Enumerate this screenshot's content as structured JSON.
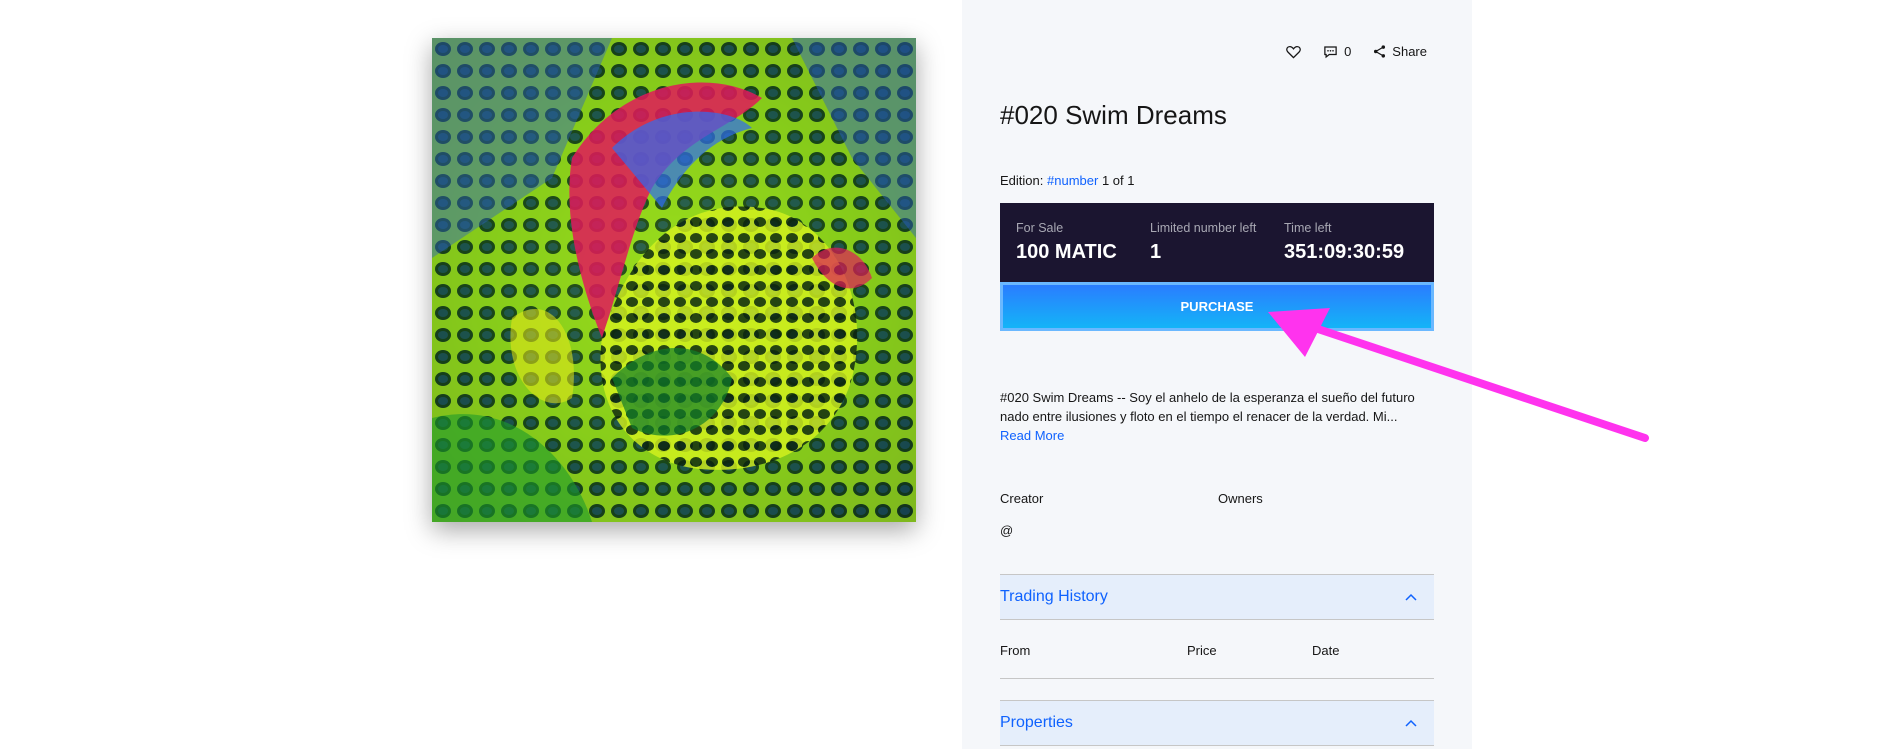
{
  "actions": {
    "comment_count": "0",
    "share_label": "Share"
  },
  "item": {
    "title": "#020 Swim Dreams",
    "edition_label": "Edition:",
    "edition_tag": "#number",
    "edition_value": "1 of 1"
  },
  "sale": {
    "for_sale_label": "For Sale",
    "for_sale_value": "100 MATIC",
    "limited_label": "Limited number left",
    "limited_value": "1",
    "time_label": "Time left",
    "time_value": "351:09:30:59",
    "purchase_label": "PURCHASE"
  },
  "description": {
    "text": "#020 Swim Dreams -- Soy el anhelo de la esperanza el sueño del futuro nado entre ilusiones y floto en el tiempo el renacer de la verdad. Mi...",
    "read_more": "Read More"
  },
  "people": {
    "creator_label": "Creator",
    "owners_label": "Owners",
    "creator_handle": "@"
  },
  "trading_history": {
    "title": "Trading History",
    "columns": [
      "From",
      "Price",
      "Date"
    ]
  },
  "properties": {
    "title": "Properties"
  },
  "colors": {
    "accent": "#0f62fe",
    "sale_box_bg": "#1b1530",
    "panel_bg": "#f5f7fa",
    "annotation_arrow": "#ff33ee"
  },
  "icons": [
    "heart-icon",
    "comment-icon",
    "share-icon",
    "chevron-up-icon"
  ]
}
